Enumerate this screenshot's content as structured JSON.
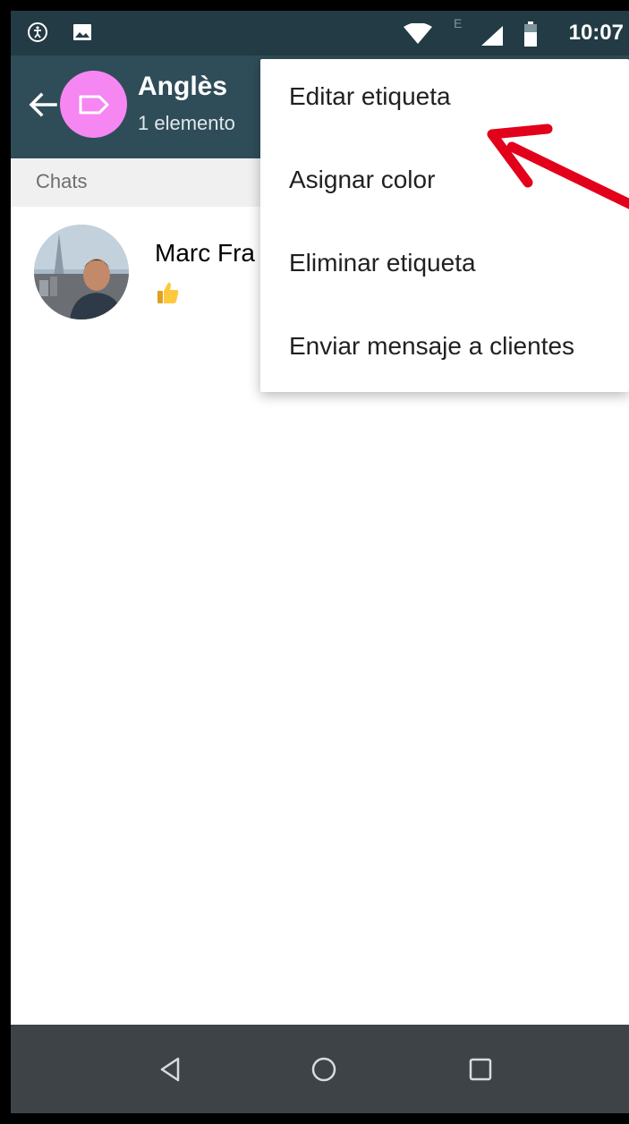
{
  "status_bar": {
    "time": "10:07",
    "network_letter": "E",
    "icons": [
      "accessibility-icon",
      "image-icon",
      "wifi-icon",
      "cell-signal-icon",
      "battery-icon"
    ]
  },
  "app_bar": {
    "title": "Anglès",
    "subtitle": "1 elemento",
    "label_color": "#f687f2",
    "icons": [
      "back-arrow-icon",
      "label-tag-icon"
    ]
  },
  "section": {
    "label": "Chats"
  },
  "chats": [
    {
      "name": "Marc Fra",
      "preview_icon": "thumbs-up-emoji"
    }
  ],
  "menu": {
    "items": [
      {
        "label": "Editar etiqueta"
      },
      {
        "label": "Asignar color"
      },
      {
        "label": "Eliminar etiqueta"
      },
      {
        "label": "Enviar mensaje a clientes"
      }
    ]
  },
  "annotation": {
    "type": "arrow",
    "color": "#e2001a",
    "points_to": "Editar etiqueta"
  },
  "nav_bar": {
    "icons": [
      "back-triangle-icon",
      "home-circle-icon",
      "recents-square-icon"
    ]
  },
  "colors": {
    "status_bar": "#233b44",
    "app_bar": "#2f4d58",
    "section_background": "#f0f0f0",
    "nav_bar": "#3d4347"
  }
}
